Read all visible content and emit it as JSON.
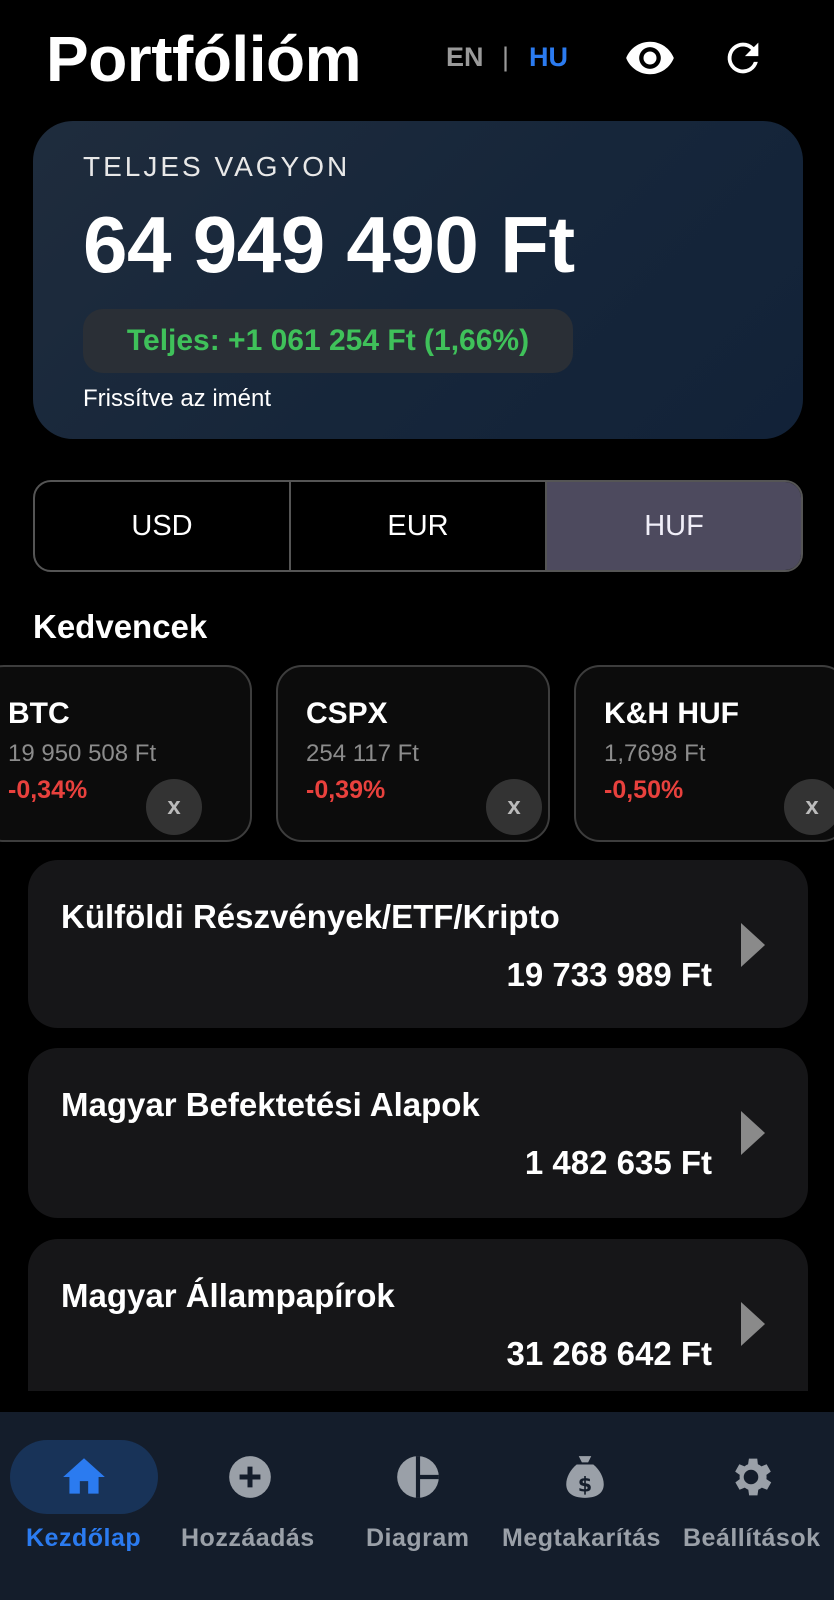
{
  "header": {
    "title": "Portfólióm",
    "lang_en": "EN",
    "lang_sep": "|",
    "lang_hu": "HU",
    "active_lang": "HU",
    "icons": [
      "eye-icon",
      "refresh-icon"
    ]
  },
  "summary": {
    "label": "TELJES VAGYON",
    "total": "64 949 490 Ft",
    "change": "Teljes: +1 061 254 Ft (1,66%)",
    "updated": "Frissítve az imént"
  },
  "currency": {
    "options": [
      "USD",
      "EUR",
      "HUF"
    ],
    "selected": "HUF"
  },
  "favorites": {
    "title": "Kedvencek",
    "remove_label": "x",
    "items": [
      {
        "name": "BTC",
        "price": "19 950 508 Ft",
        "change": "-0,34%"
      },
      {
        "name": "CSPX",
        "price": "254 117 Ft",
        "change": "-0,39%"
      },
      {
        "name": "K&H HUF",
        "price": "1,7698 Ft",
        "change": "-0,50%"
      }
    ]
  },
  "categories": [
    {
      "name": "Külföldi Részvények/ETF/Kripto",
      "value": "19 733 989 Ft"
    },
    {
      "name": "Magyar Befektetési Alapok",
      "value": "1 482 635 Ft"
    },
    {
      "name": "Magyar Állampapírok",
      "value": "31 268 642 Ft"
    }
  ],
  "nav": {
    "active": "Kezdőlap",
    "items": [
      {
        "label": "Kezdőlap",
        "icon": "home-icon"
      },
      {
        "label": "Hozzáadás",
        "icon": "add-circle-icon"
      },
      {
        "label": "Diagram",
        "icon": "pie-chart-icon"
      },
      {
        "label": "Megtakarítás",
        "icon": "money-bag-icon"
      },
      {
        "label": "Beállítások",
        "icon": "gear-icon"
      }
    ]
  },
  "colors": {
    "accent": "#2b7bf0",
    "positive": "#3fc15a",
    "negative": "#e8413d",
    "summary_card": "#1b2a3c",
    "nav_bg": "#141d2b"
  }
}
